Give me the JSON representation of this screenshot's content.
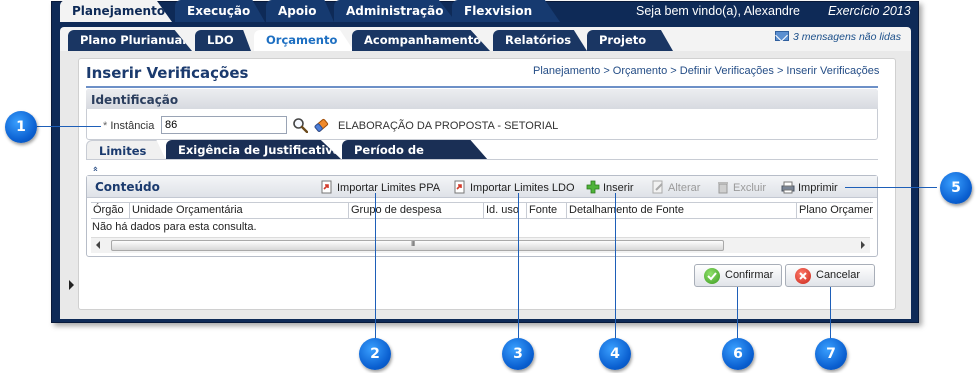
{
  "top_tabs": [
    "Planejamento",
    "Execução",
    "Apoio",
    "Administração",
    "Flexvision"
  ],
  "welcome": "Seja bem vindo(a), Alexandre",
  "exercicio": "Exercício 2013",
  "sub_tabs": [
    "Plano Plurianual",
    "LDO",
    "Orçamento",
    "Acompanhamento",
    "Relatórios",
    "Projeto"
  ],
  "messages": "3 mensagens não lidas",
  "page": {
    "title": "Inserir Verificações",
    "breadcrumb": "Planejamento > Orçamento > Definir Verificações > Inserir Verificações"
  },
  "identificacao": {
    "title": "Identificação",
    "instancia_label": "Instância",
    "required_marker": "*",
    "instancia_value": "86",
    "instancia_desc": "ELABORAÇÃO DA PROPOSTA - SETORIAL"
  },
  "inner_tabs": [
    "Limites",
    "Exigência de Justificativa",
    "Período de Captação"
  ],
  "collapse_glyph": "»",
  "grid": {
    "title": "Conteúdo",
    "toolbar": {
      "importar_ppa": "Importar Limites PPA",
      "importar_ldo": "Importar Limites LDO",
      "inserir": "Inserir",
      "alterar": "Alterar",
      "excluir": "Excluir",
      "imprimir": "Imprimir"
    },
    "columns": [
      "Órgão",
      "Unidade Orçamentária",
      "Grupo de despesa",
      "Id. uso",
      "Fonte",
      "Detalhamento de Fonte",
      "Plano Orçamer"
    ],
    "empty_message": "Não há dados para esta consulta.",
    "scroll_grip": "III"
  },
  "buttons": {
    "confirmar": "Confirmar",
    "cancelar": "Cancelar"
  },
  "callouts": [
    "1",
    "2",
    "3",
    "4",
    "5",
    "6",
    "7"
  ],
  "colors": {
    "frame": "#0e2a57",
    "callout": "#0a5fd0",
    "active_tab_text": "#1d6fc2"
  }
}
